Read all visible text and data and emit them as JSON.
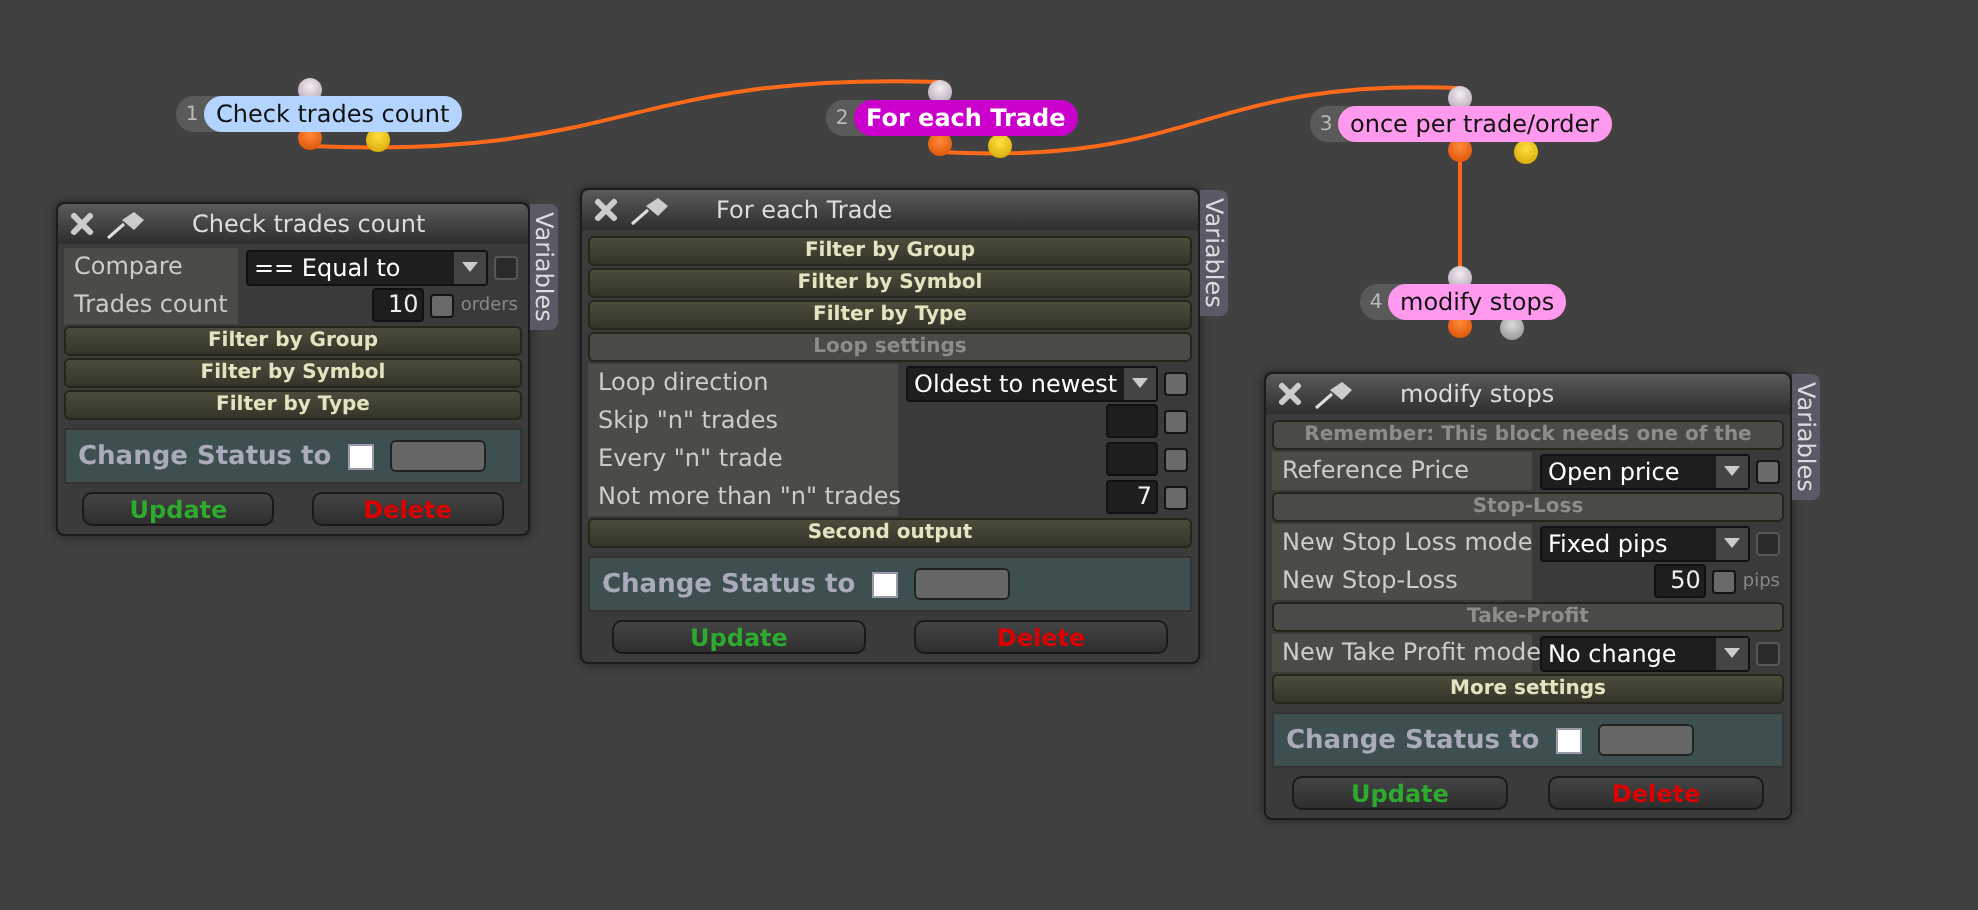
{
  "nodes": [
    {
      "number": "1",
      "label": "Check trades count",
      "color": "#b3d4ff",
      "selected": false,
      "second_output": true
    },
    {
      "number": "2",
      "label": "For each Trade",
      "color": "#cc00cc",
      "selected": true,
      "second_output": true
    },
    {
      "number": "3",
      "label": "once per trade/order",
      "color": "#ff99ee",
      "selected": false,
      "second_output": true
    },
    {
      "number": "4",
      "label": "modify stops",
      "color": "#ff99ee",
      "selected": false,
      "second_output": false
    }
  ],
  "panels": [
    {
      "title": "Check trades count",
      "side_tab": "Variables",
      "rows": [
        {
          "kind": "select",
          "label": "Compare",
          "value": "== Equal to",
          "checkbox_enabled": false
        },
        {
          "kind": "number",
          "label": "Trades count",
          "value": "10",
          "unit": "orders",
          "checkbox_enabled": true
        },
        {
          "kind": "section",
          "label": "Filter by Group",
          "expanded": false
        },
        {
          "kind": "section",
          "label": "Filter by Symbol",
          "expanded": false
        },
        {
          "kind": "section",
          "label": "Filter by Type",
          "expanded": false
        }
      ],
      "status": {
        "label": "Change Status to",
        "checked": false
      },
      "buttons": [
        {
          "label": "Update",
          "kind": "update"
        },
        {
          "label": "Delete",
          "kind": "delete"
        }
      ]
    },
    {
      "title": "For each Trade",
      "side_tab": "Variables",
      "rows": [
        {
          "kind": "section",
          "label": "Filter by Group",
          "expanded": false
        },
        {
          "kind": "section",
          "label": "Filter by Symbol",
          "expanded": false
        },
        {
          "kind": "section",
          "label": "Filter by Type",
          "expanded": false
        },
        {
          "kind": "section",
          "label": "Loop settings",
          "expanded": true
        },
        {
          "kind": "select",
          "label": "Loop direction",
          "value": "Oldest to newest",
          "checkbox_enabled": true
        },
        {
          "kind": "number",
          "label": "Skip \"n\" trades",
          "checkbox_enabled": true
        },
        {
          "kind": "number",
          "label": "Every \"n\" trade",
          "checkbox_enabled": true
        },
        {
          "kind": "number",
          "label": "Not more than \"n\" trades",
          "value": "7",
          "checkbox_enabled": true
        },
        {
          "kind": "section",
          "label": "Second output",
          "expanded": false
        }
      ],
      "status": {
        "label": "Change Status to",
        "checked": false
      },
      "buttons": [
        {
          "label": "Update",
          "kind": "update"
        },
        {
          "label": "Delete",
          "kind": "delete"
        }
      ]
    },
    {
      "title": "modify stops",
      "side_tab": "Variables",
      "rows": [
        {
          "kind": "section",
          "label": "Remember: This block needs one of the",
          "expanded": true
        },
        {
          "kind": "select",
          "label": "Reference Price",
          "value": "Open price",
          "checkbox_enabled": true
        },
        {
          "kind": "section",
          "label": "Stop-Loss",
          "expanded": true
        },
        {
          "kind": "select",
          "label": "New Stop Loss mode",
          "value": "Fixed pips",
          "checkbox_enabled": false
        },
        {
          "kind": "number",
          "label": "New Stop-Loss",
          "value": "50",
          "unit": "pips",
          "checkbox_enabled": true
        },
        {
          "kind": "section",
          "label": "Take-Profit",
          "expanded": true
        },
        {
          "kind": "select",
          "label": "New Take Profit mode",
          "value": "No change",
          "checkbox_enabled": false
        },
        {
          "kind": "section",
          "label": "More settings",
          "expanded": false
        }
      ],
      "status": {
        "label": "Change Status to",
        "checked": false
      },
      "buttons": [
        {
          "label": "Update",
          "kind": "update"
        },
        {
          "label": "Delete",
          "kind": "delete"
        }
      ]
    }
  ]
}
